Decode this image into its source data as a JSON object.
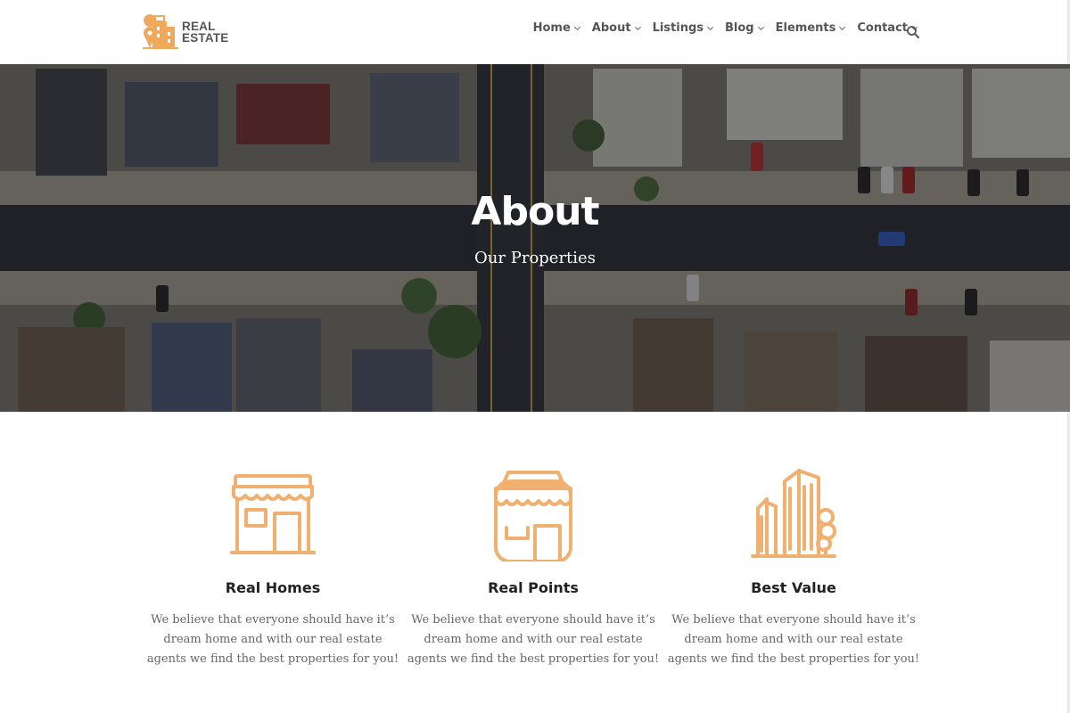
{
  "brand": {
    "line1": "REAL",
    "line2": "ESTATE",
    "accent": "#f0a85a",
    "text_color": "#555555"
  },
  "nav": {
    "items": [
      {
        "label": "Home"
      },
      {
        "label": "About"
      },
      {
        "label": "Listings"
      },
      {
        "label": "Blog"
      },
      {
        "label": "Elements"
      },
      {
        "label": "Contact"
      }
    ],
    "search_icon": "search-icon"
  },
  "hero": {
    "title": "About",
    "subtitle": "Our Properties"
  },
  "features": [
    {
      "icon": "storefront-icon",
      "title": "Real Homes",
      "text": "We believe that everyone should have it’s dream home and with our real estate agents we find the best properties for you!"
    },
    {
      "icon": "shop-icon",
      "title": "Real Points",
      "text": "We believe that everyone should have it’s dream home and with our real estate agents we find the best properties for you!"
    },
    {
      "icon": "buildings-icon",
      "title": "Best Value",
      "text": "We believe that everyone should have it’s dream home and with our real estate agents we find the best properties for you!"
    }
  ]
}
